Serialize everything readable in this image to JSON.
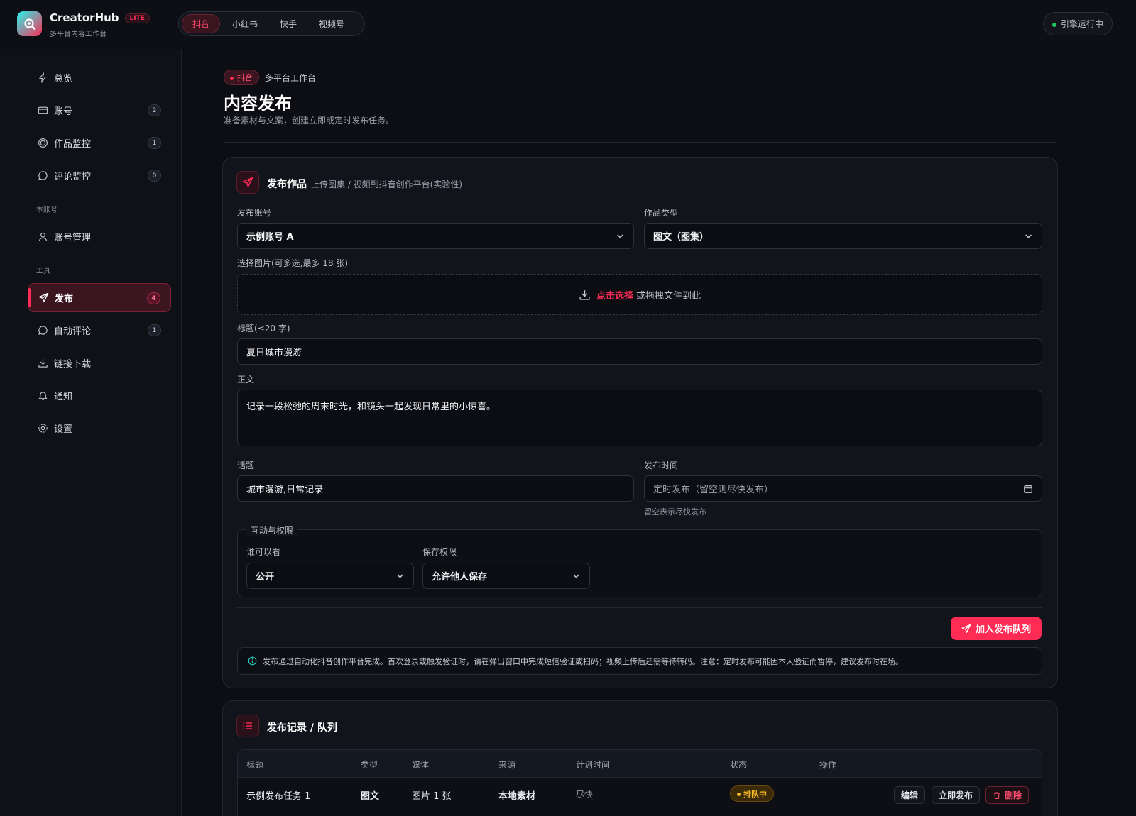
{
  "app": {
    "name": "CreatorHub",
    "edition": "LITE",
    "subtitle": "多平台内容工作台"
  },
  "platform_tabs": [
    {
      "label": "抖音",
      "active": true
    },
    {
      "label": "小红书"
    },
    {
      "label": "快手"
    },
    {
      "label": "视频号"
    }
  ],
  "engine_status": "引擎运行中",
  "sidebar": {
    "items": [
      {
        "label": "总览",
        "icon": "bolt-icon"
      },
      {
        "label": "账号",
        "icon": "card-icon",
        "badge": "2"
      },
      {
        "label": "作品监控",
        "icon": "target-icon",
        "badge": "1"
      },
      {
        "label": "评论监控",
        "icon": "comment-icon",
        "badge": "0"
      }
    ],
    "section_account": "本账号",
    "account_items": [
      {
        "label": "账号管理",
        "icon": "user-icon"
      }
    ],
    "section_tools": "工具",
    "tool_items": [
      {
        "label": "发布",
        "icon": "send-icon",
        "badge": "4",
        "active": true
      },
      {
        "label": "自动评论",
        "icon": "comment-icon",
        "badge": "1"
      },
      {
        "label": "链接下载",
        "icon": "download-icon"
      },
      {
        "label": "通知",
        "icon": "bell-icon"
      },
      {
        "label": "设置",
        "icon": "gear-icon"
      }
    ]
  },
  "header": {
    "platform_pill": "抖音",
    "crumb": "多平台工作台",
    "title": "内容发布",
    "description": "准备素材与文案，创建立即或定时发布任务。"
  },
  "publish_card": {
    "title": "发布作品",
    "subtitle": "上传图集 / 视频到抖音创作平台(实验性)",
    "account_label": "发布账号",
    "account_value": "示例账号 A",
    "type_label": "作品类型",
    "type_value": "图文（图集）",
    "images_label": "选择图片(可多选,最多 18 张)",
    "drop_pick": "点击选择",
    "drop_text": "或拖拽文件到此",
    "title_label": "标题(≤20 字)",
    "title_value": "夏日城市漫游",
    "body_label": "正文",
    "body_value": "记录一段松弛的周末时光，和镜头一起发现日常里的小惊喜。",
    "topic_label": "话题",
    "topic_value": "城市漫游,日常记录",
    "time_label": "发布时间",
    "time_placeholder": "定时发布（留空则尽快发布）",
    "time_hint": "留空表示尽快发布",
    "perm_legend": "互动与权限",
    "visibility_label": "谁可以看",
    "visibility_value": "公开",
    "save_label": "保存权限",
    "save_value": "允许他人保存",
    "submit": "加入发布队列",
    "notice": "发布通过自动化抖音创作平台完成。首次登录或触发验证时，请在弹出窗口中完成短信验证或扫码；视频上传后还需等待转码。注意：定时发布可能因本人验证而暂停，建议发布时在场。"
  },
  "records_card": {
    "title": "发布记录 / 队列",
    "columns": [
      "标题",
      "类型",
      "媒体",
      "来源",
      "计划时间",
      "状态",
      "操作"
    ],
    "rows": [
      {
        "title": "示例发布任务 1",
        "type": "图文",
        "media": "图片 1 张",
        "source": "本地素材",
        "time": "尽快",
        "status": "排队中"
      }
    ],
    "actions": {
      "edit": "编辑",
      "publish_now": "立即发布",
      "delete": "删除"
    }
  },
  "colors": {
    "accent": "#fe2c55",
    "background": "#0c0e13",
    "status_queued": "#f5b72a",
    "online": "#22c55e"
  }
}
